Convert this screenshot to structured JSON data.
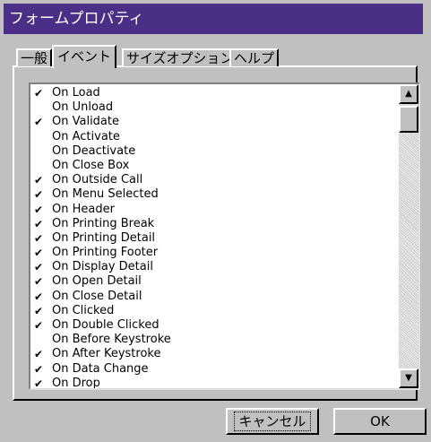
{
  "window": {
    "title": "フォームプロパティ"
  },
  "tabs": [
    {
      "label": "一般",
      "active": false
    },
    {
      "label": "イベント",
      "active": true
    },
    {
      "label": "サイズオプション",
      "active": false
    },
    {
      "label": "ヘルプ",
      "active": false
    }
  ],
  "events": [
    {
      "label": "On Load",
      "checked": true
    },
    {
      "label": "On Unload",
      "checked": false
    },
    {
      "label": "On Validate",
      "checked": true
    },
    {
      "label": "On Activate",
      "checked": false
    },
    {
      "label": "On Deactivate",
      "checked": false
    },
    {
      "label": "On Close Box",
      "checked": false
    },
    {
      "label": "On Outside Call",
      "checked": true
    },
    {
      "label": "On Menu Selected",
      "checked": true
    },
    {
      "label": "On Header",
      "checked": true
    },
    {
      "label": "On Printing Break",
      "checked": true
    },
    {
      "label": "On Printing Detail",
      "checked": true
    },
    {
      "label": "On Printing Footer",
      "checked": true
    },
    {
      "label": "On Display Detail",
      "checked": true
    },
    {
      "label": "On Open Detail",
      "checked": true
    },
    {
      "label": "On Close Detail",
      "checked": true
    },
    {
      "label": "On Clicked",
      "checked": true
    },
    {
      "label": "On Double Clicked",
      "checked": true
    },
    {
      "label": "On Before Keystroke",
      "checked": false
    },
    {
      "label": "On After Keystroke",
      "checked": true
    },
    {
      "label": "On Data Change",
      "checked": true
    },
    {
      "label": "On Drop",
      "checked": true
    }
  ],
  "icons": {
    "check": "checkmark-icon",
    "up": "scroll-up-arrow-icon",
    "down": "scroll-down-arrow-icon"
  },
  "buttons": {
    "cancel_label": "キャンセル",
    "ok_label": "OK"
  }
}
